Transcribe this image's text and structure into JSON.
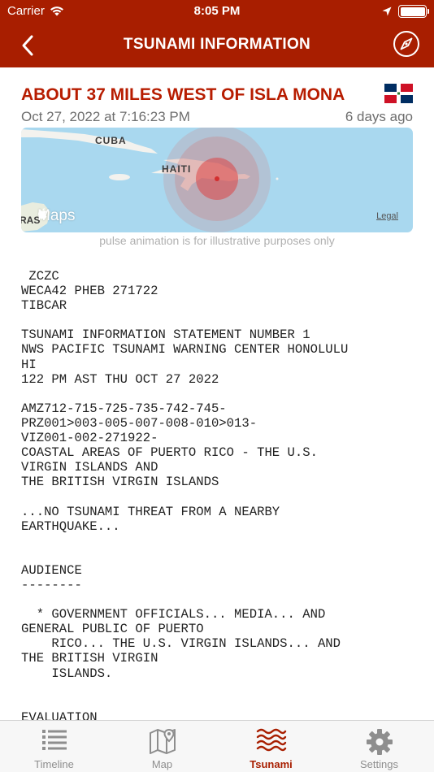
{
  "status_bar": {
    "carrier": "Carrier",
    "time": "8:05 PM"
  },
  "nav": {
    "title": "TSUNAMI INFORMATION"
  },
  "event": {
    "title": "ABOUT 37 MILES WEST OF ISLA MONA",
    "date": "Oct 27, 2022 at 7:16:23 PM",
    "ago": "6 days ago",
    "flag": "dominican-republic-flag"
  },
  "map": {
    "labels": {
      "cuba": "CUBA",
      "haiti": "HAITI",
      "edge": "RAS"
    },
    "maps_brand": "Maps",
    "legal": "Legal",
    "caption": "pulse animation is for illustrative purposes only"
  },
  "bulletin": {
    "text": " ZCZC\nWECA42 PHEB 271722\nTIBCAR\n\nTSUNAMI INFORMATION STATEMENT NUMBER 1\nNWS PACIFIC TSUNAMI WARNING CENTER HONOLULU\nHI\n122 PM AST THU OCT 27 2022\n\nAMZ712-715-725-735-742-745-\nPRZ001>003-005-007-008-010>013-\nVIZ001-002-271922-\nCOASTAL AREAS OF PUERTO RICO - THE U.S.\nVIRGIN ISLANDS AND\nTHE BRITISH VIRGIN ISLANDS\n\n...NO TSUNAMI THREAT FROM A NEARBY\nEARTHQUAKE...\n\n\nAUDIENCE\n--------\n\n  * GOVERNMENT OFFICIALS... MEDIA... AND\nGENERAL PUBLIC OF PUERTO\n    RICO... THE U.S. VIRGIN ISLANDS... AND\nTHE BRITISH VIRGIN\n    ISLANDS.\n\n\nEVALUATION"
  },
  "tabs": [
    {
      "label": "Timeline",
      "icon": "list-icon",
      "active": false
    },
    {
      "label": "Map",
      "icon": "map-icon",
      "active": false
    },
    {
      "label": "Tsunami",
      "icon": "waves-icon",
      "active": true
    },
    {
      "label": "Settings",
      "icon": "gear-icon",
      "active": false
    }
  ],
  "colors": {
    "brand": "#a81e00",
    "title": "#b71c00",
    "inactive_tab": "#8e8e8e"
  }
}
